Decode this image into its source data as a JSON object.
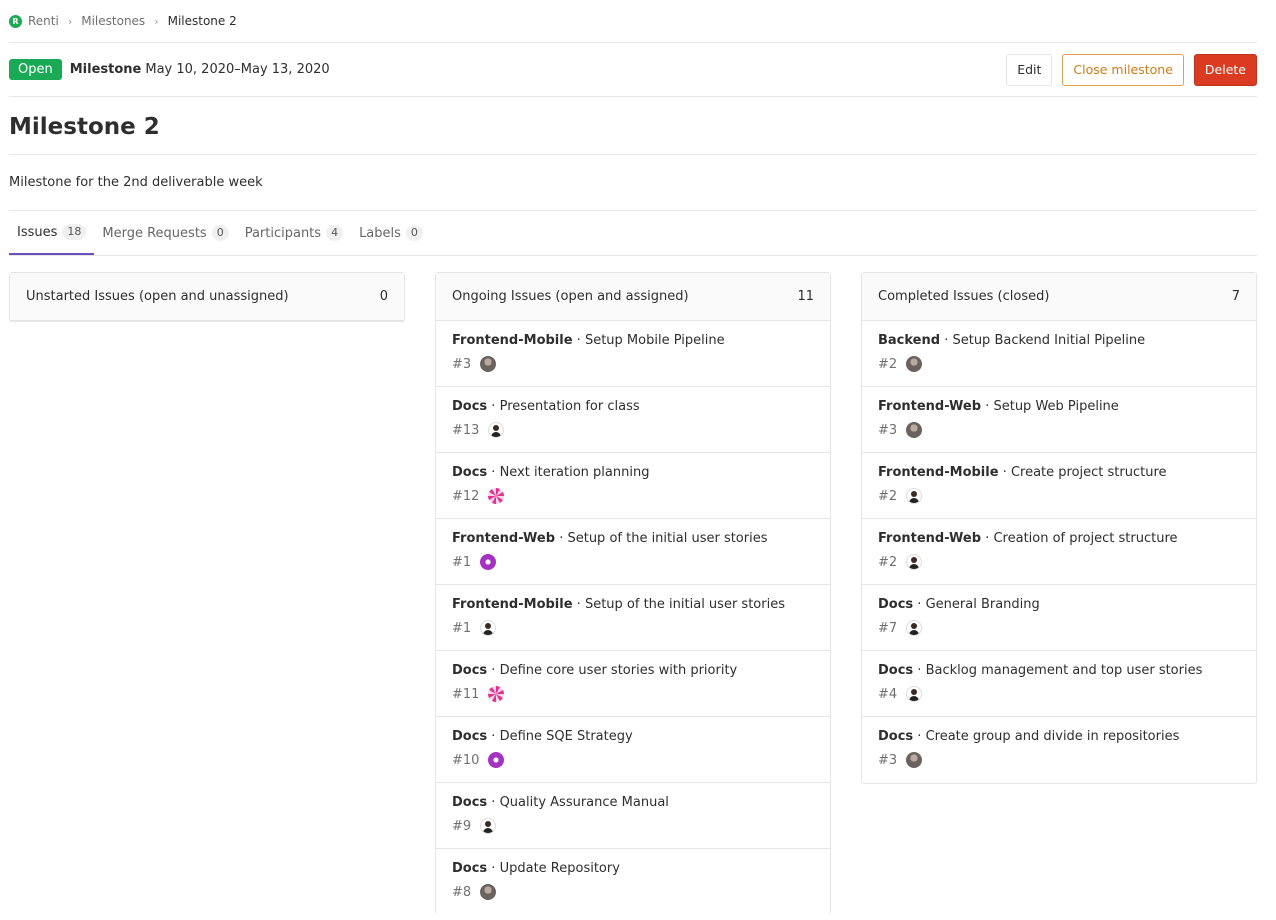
{
  "breadcrumb": {
    "logo_letter": "R",
    "project": "Renti",
    "section": "Milestones",
    "current": "Milestone 2"
  },
  "header": {
    "status": "Open",
    "label": "Milestone",
    "dates": "May 10, 2020–May 13, 2020",
    "edit": "Edit",
    "close": "Close milestone",
    "delete": "Delete"
  },
  "title": "Milestone 2",
  "description": "Milestone for the 2nd deliverable week",
  "tabs": [
    {
      "label": "Issues",
      "count": "18"
    },
    {
      "label": "Merge Requests",
      "count": "0"
    },
    {
      "label": "Participants",
      "count": "4"
    },
    {
      "label": "Labels",
      "count": "0"
    }
  ],
  "columns": {
    "unstarted": {
      "title": "Unstarted Issues (open and unassigned)",
      "count": "0"
    },
    "ongoing": {
      "title": "Ongoing Issues (open and assigned)",
      "count": "11",
      "issues": [
        {
          "project": "Frontend-Mobile",
          "title": "Setup Mobile Pipeline",
          "ref": "#3",
          "avatar": "photo"
        },
        {
          "project": "Docs",
          "title": "Presentation for class",
          "ref": "#13",
          "avatar": "person"
        },
        {
          "project": "Docs",
          "title": "Next iteration planning",
          "ref": "#12",
          "avatar": "pattern-pink"
        },
        {
          "project": "Frontend-Web",
          "title": "Setup of the initial user stories",
          "ref": "#1",
          "avatar": "pattern-purple"
        },
        {
          "project": "Frontend-Mobile",
          "title": "Setup of the initial user stories",
          "ref": "#1",
          "avatar": "person"
        },
        {
          "project": "Docs",
          "title": "Define core user stories with priority",
          "ref": "#11",
          "avatar": "pattern-pink"
        },
        {
          "project": "Docs",
          "title": "Define SQE Strategy",
          "ref": "#10",
          "avatar": "pattern-purple"
        },
        {
          "project": "Docs",
          "title": "Quality Assurance Manual",
          "ref": "#9",
          "avatar": "person"
        },
        {
          "project": "Docs",
          "title": "Update Repository",
          "ref": "#8",
          "avatar": "photo"
        }
      ]
    },
    "completed": {
      "title": "Completed Issues (closed)",
      "count": "7",
      "issues": [
        {
          "project": "Backend",
          "title": "Setup Backend Initial Pipeline",
          "ref": "#2",
          "avatar": "photo"
        },
        {
          "project": "Frontend-Web",
          "title": "Setup Web Pipeline",
          "ref": "#3",
          "avatar": "photo"
        },
        {
          "project": "Frontend-Mobile",
          "title": "Create project structure",
          "ref": "#2",
          "avatar": "person"
        },
        {
          "project": "Frontend-Web",
          "title": "Creation of project structure",
          "ref": "#2",
          "avatar": "person"
        },
        {
          "project": "Docs",
          "title": "General Branding",
          "ref": "#7",
          "avatar": "person"
        },
        {
          "project": "Docs",
          "title": "Backlog management and top user stories",
          "ref": "#4",
          "avatar": "person"
        },
        {
          "project": "Docs",
          "title": "Create group and divide in repositories",
          "ref": "#3",
          "avatar": "photo"
        }
      ]
    }
  },
  "separator": " · "
}
